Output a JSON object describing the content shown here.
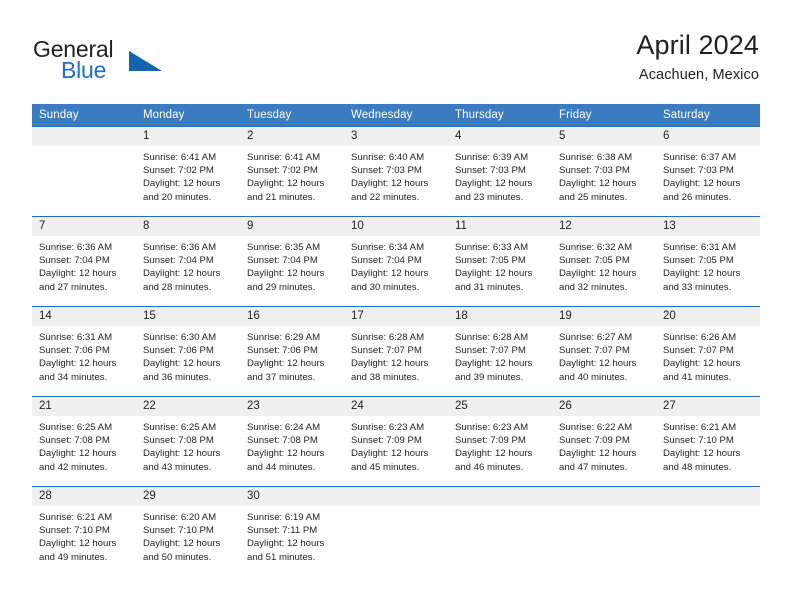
{
  "brand": {
    "name_part1": "General",
    "name_part2": "Blue",
    "triangle_color": "#1064b0",
    "blue_color": "#1f6fc4"
  },
  "header": {
    "title": "April 2024",
    "subtitle": "Acachuen, Mexico"
  },
  "theme": {
    "header_row_bg": "#3b7cc0",
    "row_border": "#1f6fc4",
    "daynum_bg": "#f0f0f0",
    "text": "#231f20"
  },
  "weekday_headers": [
    "Sunday",
    "Monday",
    "Tuesday",
    "Wednesday",
    "Thursday",
    "Friday",
    "Saturday"
  ],
  "weeks": [
    [
      {
        "day": "",
        "lines": []
      },
      {
        "day": "1",
        "lines": [
          "Sunrise: 6:41 AM",
          "Sunset: 7:02 PM",
          "Daylight: 12 hours",
          "and 20 minutes."
        ]
      },
      {
        "day": "2",
        "lines": [
          "Sunrise: 6:41 AM",
          "Sunset: 7:02 PM",
          "Daylight: 12 hours",
          "and 21 minutes."
        ]
      },
      {
        "day": "3",
        "lines": [
          "Sunrise: 6:40 AM",
          "Sunset: 7:03 PM",
          "Daylight: 12 hours",
          "and 22 minutes."
        ]
      },
      {
        "day": "4",
        "lines": [
          "Sunrise: 6:39 AM",
          "Sunset: 7:03 PM",
          "Daylight: 12 hours",
          "and 23 minutes."
        ]
      },
      {
        "day": "5",
        "lines": [
          "Sunrise: 6:38 AM",
          "Sunset: 7:03 PM",
          "Daylight: 12 hours",
          "and 25 minutes."
        ]
      },
      {
        "day": "6",
        "lines": [
          "Sunrise: 6:37 AM",
          "Sunset: 7:03 PM",
          "Daylight: 12 hours",
          "and 26 minutes."
        ]
      }
    ],
    [
      {
        "day": "7",
        "lines": [
          "Sunrise: 6:36 AM",
          "Sunset: 7:04 PM",
          "Daylight: 12 hours",
          "and 27 minutes."
        ]
      },
      {
        "day": "8",
        "lines": [
          "Sunrise: 6:36 AM",
          "Sunset: 7:04 PM",
          "Daylight: 12 hours",
          "and 28 minutes."
        ]
      },
      {
        "day": "9",
        "lines": [
          "Sunrise: 6:35 AM",
          "Sunset: 7:04 PM",
          "Daylight: 12 hours",
          "and 29 minutes."
        ]
      },
      {
        "day": "10",
        "lines": [
          "Sunrise: 6:34 AM",
          "Sunset: 7:04 PM",
          "Daylight: 12 hours",
          "and 30 minutes."
        ]
      },
      {
        "day": "11",
        "lines": [
          "Sunrise: 6:33 AM",
          "Sunset: 7:05 PM",
          "Daylight: 12 hours",
          "and 31 minutes."
        ]
      },
      {
        "day": "12",
        "lines": [
          "Sunrise: 6:32 AM",
          "Sunset: 7:05 PM",
          "Daylight: 12 hours",
          "and 32 minutes."
        ]
      },
      {
        "day": "13",
        "lines": [
          "Sunrise: 6:31 AM",
          "Sunset: 7:05 PM",
          "Daylight: 12 hours",
          "and 33 minutes."
        ]
      }
    ],
    [
      {
        "day": "14",
        "lines": [
          "Sunrise: 6:31 AM",
          "Sunset: 7:06 PM",
          "Daylight: 12 hours",
          "and 34 minutes."
        ]
      },
      {
        "day": "15",
        "lines": [
          "Sunrise: 6:30 AM",
          "Sunset: 7:06 PM",
          "Daylight: 12 hours",
          "and 36 minutes."
        ]
      },
      {
        "day": "16",
        "lines": [
          "Sunrise: 6:29 AM",
          "Sunset: 7:06 PM",
          "Daylight: 12 hours",
          "and 37 minutes."
        ]
      },
      {
        "day": "17",
        "lines": [
          "Sunrise: 6:28 AM",
          "Sunset: 7:07 PM",
          "Daylight: 12 hours",
          "and 38 minutes."
        ]
      },
      {
        "day": "18",
        "lines": [
          "Sunrise: 6:28 AM",
          "Sunset: 7:07 PM",
          "Daylight: 12 hours",
          "and 39 minutes."
        ]
      },
      {
        "day": "19",
        "lines": [
          "Sunrise: 6:27 AM",
          "Sunset: 7:07 PM",
          "Daylight: 12 hours",
          "and 40 minutes."
        ]
      },
      {
        "day": "20",
        "lines": [
          "Sunrise: 6:26 AM",
          "Sunset: 7:07 PM",
          "Daylight: 12 hours",
          "and 41 minutes."
        ]
      }
    ],
    [
      {
        "day": "21",
        "lines": [
          "Sunrise: 6:25 AM",
          "Sunset: 7:08 PM",
          "Daylight: 12 hours",
          "and 42 minutes."
        ]
      },
      {
        "day": "22",
        "lines": [
          "Sunrise: 6:25 AM",
          "Sunset: 7:08 PM",
          "Daylight: 12 hours",
          "and 43 minutes."
        ]
      },
      {
        "day": "23",
        "lines": [
          "Sunrise: 6:24 AM",
          "Sunset: 7:08 PM",
          "Daylight: 12 hours",
          "and 44 minutes."
        ]
      },
      {
        "day": "24",
        "lines": [
          "Sunrise: 6:23 AM",
          "Sunset: 7:09 PM",
          "Daylight: 12 hours",
          "and 45 minutes."
        ]
      },
      {
        "day": "25",
        "lines": [
          "Sunrise: 6:23 AM",
          "Sunset: 7:09 PM",
          "Daylight: 12 hours",
          "and 46 minutes."
        ]
      },
      {
        "day": "26",
        "lines": [
          "Sunrise: 6:22 AM",
          "Sunset: 7:09 PM",
          "Daylight: 12 hours",
          "and 47 minutes."
        ]
      },
      {
        "day": "27",
        "lines": [
          "Sunrise: 6:21 AM",
          "Sunset: 7:10 PM",
          "Daylight: 12 hours",
          "and 48 minutes."
        ]
      }
    ],
    [
      {
        "day": "28",
        "lines": [
          "Sunrise: 6:21 AM",
          "Sunset: 7:10 PM",
          "Daylight: 12 hours",
          "and 49 minutes."
        ]
      },
      {
        "day": "29",
        "lines": [
          "Sunrise: 6:20 AM",
          "Sunset: 7:10 PM",
          "Daylight: 12 hours",
          "and 50 minutes."
        ]
      },
      {
        "day": "30",
        "lines": [
          "Sunrise: 6:19 AM",
          "Sunset: 7:11 PM",
          "Daylight: 12 hours",
          "and 51 minutes."
        ]
      },
      {
        "day": "",
        "lines": []
      },
      {
        "day": "",
        "lines": []
      },
      {
        "day": "",
        "lines": []
      },
      {
        "day": "",
        "lines": []
      }
    ]
  ]
}
